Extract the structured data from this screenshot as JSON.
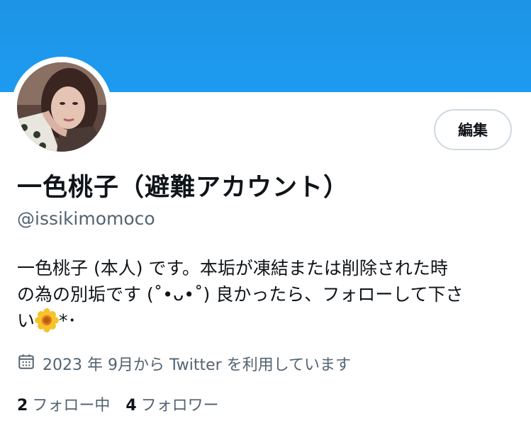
{
  "profile": {
    "display_name": "一色桃子（避難アカウント）",
    "handle": "@issikimomoco",
    "edit_button_label": "編集",
    "bio_lines": [
      "一色桃子 (本人) です。本垢が凍結または削除された時",
      "の為の別垢です (˚•ᴗ•˚) 良かったら、フォローして下さ",
      "い"
    ],
    "bio_tail": "*･",
    "joined_text": "2023 年 9月から Twitter を利用しています",
    "following_count": "2",
    "following_label": "フォロー中",
    "followers_count": "4",
    "followers_label": "フォロワー"
  },
  "colors": {
    "banner": "#1d9bf0",
    "secondary_text": "#536471",
    "primary_text": "#0f1419",
    "button_border": "#cfd9de"
  },
  "icons": {
    "calendar": "calendar-icon",
    "flower": "flower-emoji-icon"
  }
}
